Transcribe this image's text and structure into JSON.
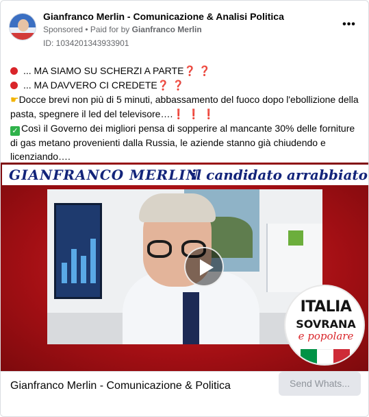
{
  "header": {
    "page_name": "Gianfranco Merlin - Comunicazione & Analisi Politica",
    "sponsored": "Sponsored",
    "separator": " • ",
    "paid_for_prefix": "Paid for by ",
    "paid_for_name": "Gianfranco Merlin",
    "ad_id": "ID: 1034201343933901",
    "more_label": "•••"
  },
  "body": {
    "line1": "... MA SIAMO SU SCHERZI A PARTE",
    "line1_suffix": "❓ ❓",
    "line2": "... MA DAVVERO CI CREDETE",
    "line2_suffix": "❓ ❓",
    "line3": "Docce brevi non più di 5 minuti, abbassamento del fuoco dopo l'ebollizione della pasta, spegnere il led del televisore….",
    "line3_suffix": "❗ ❗ ❗",
    "line4": "Così il Governo dei migliori pensa di sopperire al mancante 30% delle forniture di gas metano provenienti dalla Russia, le aziende stanno già chiudendo e licenziando…."
  },
  "media": {
    "banner_name": "GIANFRANCO MERLIN",
    "banner_tagline": "il candidato arrabbiato",
    "logo_line1": "ITALIA",
    "logo_line2": "SOVRANA",
    "logo_line3": "e popolare"
  },
  "footer": {
    "title": "Gianfranco Merlin - Comunicazione & Politica",
    "cta_label": "Send Whats..."
  },
  "icons": {
    "red_circle": "red-circle-icon",
    "question": "question-mark-icon",
    "hand": "pointing-hand-icon",
    "exclamation": "exclamation-icon",
    "check": "check-mark-icon",
    "play": "play-icon",
    "more": "more-options-icon"
  },
  "colors": {
    "accent_red": "#d9252a",
    "banner_text": "#13247a",
    "media_bg": "#b31217",
    "cta_bg": "#e4e6eb",
    "check_green": "#2fb24a",
    "flag_green": "#009246",
    "flag_white": "#ffffff",
    "flag_red": "#ce2b37"
  }
}
